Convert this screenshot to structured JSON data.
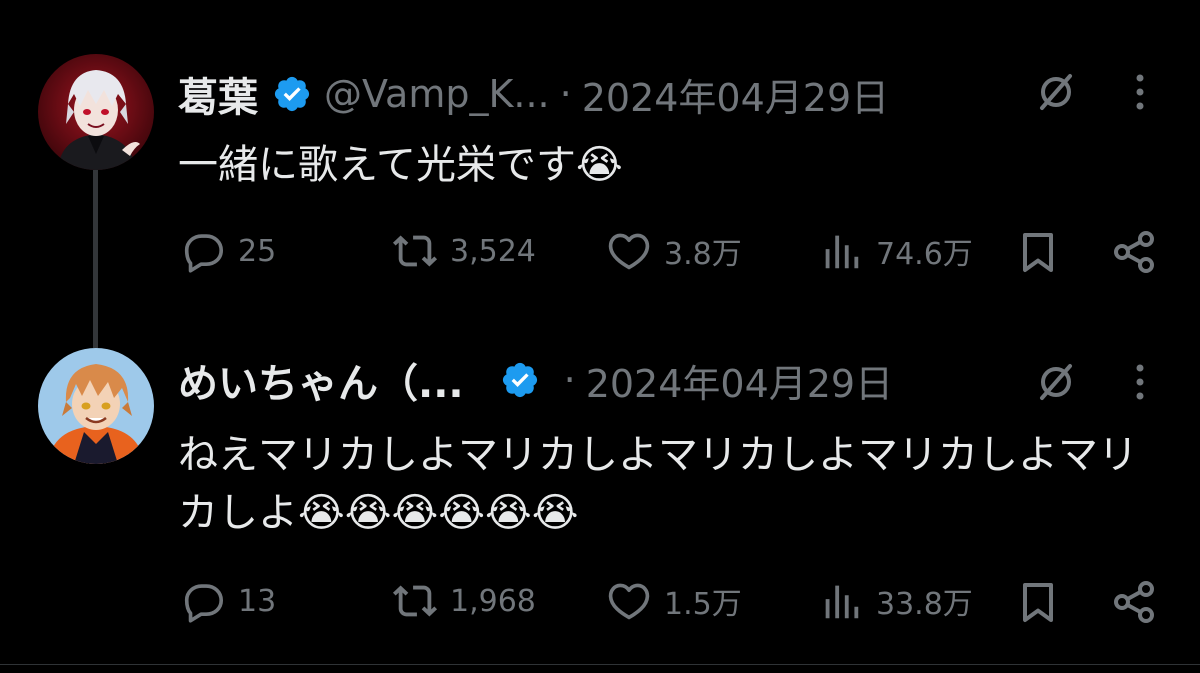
{
  "tweets": [
    {
      "display_name": "葛葉",
      "handle": "@Vamp_K...",
      "separator": "·",
      "date": "2024年04月29日",
      "text": "一緒に歌えて光栄です😭",
      "replies": "25",
      "reposts": "3,524",
      "likes": "3.8万",
      "views": "74.6万"
    },
    {
      "display_name": "めいちゃん（...",
      "handle": "",
      "separator": "·",
      "date": "2024年04月29日",
      "text": "ねえマリカしよマリカしよマリカしよマリカしよマリカしよ😭😭😭😭😭😭",
      "replies": "13",
      "reposts": "1,968",
      "likes": "1.5万",
      "views": "33.8万"
    }
  ],
  "icons": {
    "verified": "verified-badge-icon",
    "grok": "grok-icon",
    "more": "more-options-icon",
    "reply": "reply-icon",
    "repost": "repost-icon",
    "like": "like-icon",
    "views": "views-icon",
    "bookmark": "bookmark-icon",
    "share": "share-icon"
  },
  "colors": {
    "background": "#000000",
    "primary_text": "#e7e9ea",
    "secondary_text": "#71767b",
    "verified_blue": "#1d9bf0"
  }
}
